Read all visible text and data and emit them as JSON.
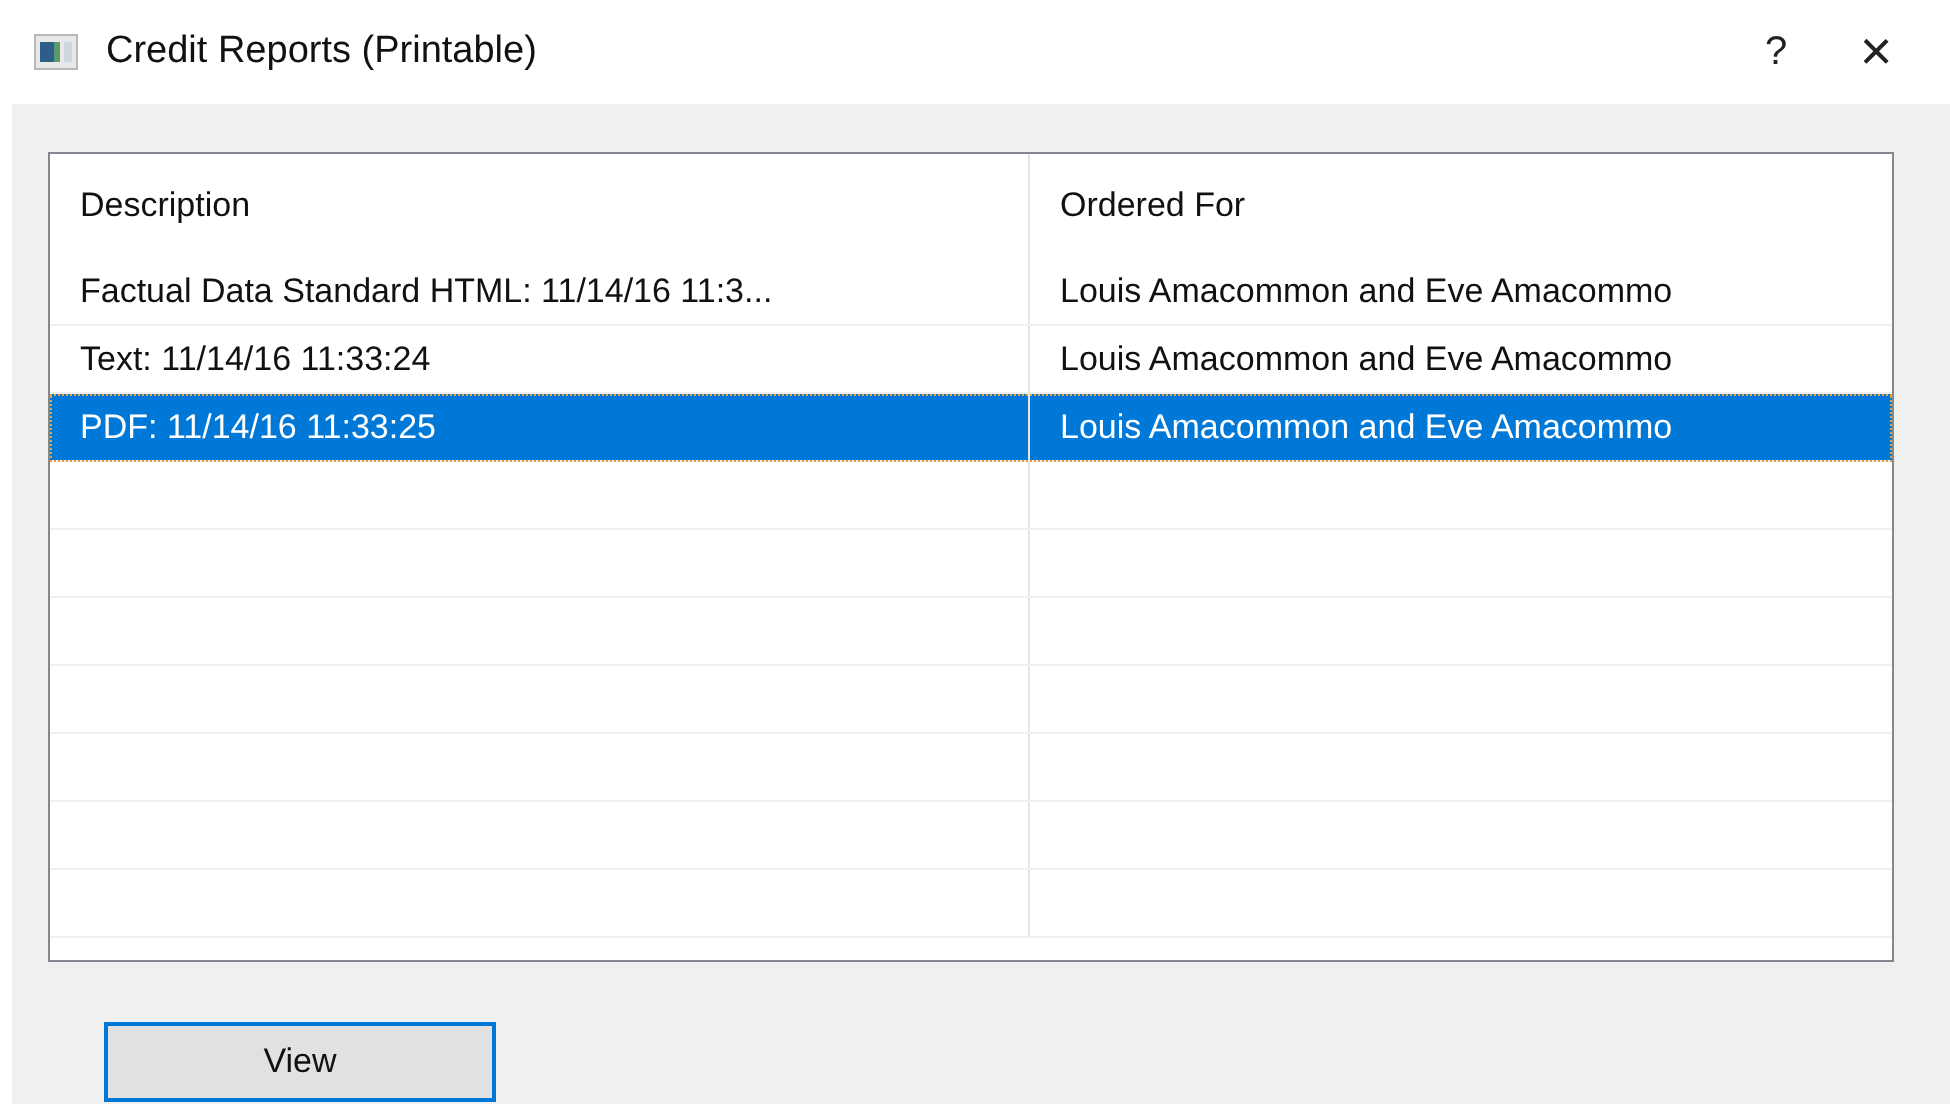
{
  "window": {
    "title": "Credit Reports (Printable)",
    "help": "?",
    "close": "×"
  },
  "table": {
    "columns": [
      "Description",
      "Ordered For"
    ],
    "rows": [
      {
        "cells": [
          "Factual Data Standard HTML: 11/14/16 11:3...",
          "Louis Amacommon and Eve Amacommo"
        ],
        "selected": false
      },
      {
        "cells": [
          "Text: 11/14/16 11:33:24",
          "Louis Amacommon and Eve Amacommo"
        ],
        "selected": false
      },
      {
        "cells": [
          "PDF: 11/14/16 11:33:25",
          "Louis Amacommon and Eve Amacommo"
        ],
        "selected": true
      }
    ]
  },
  "buttons": [
    "View"
  ]
}
